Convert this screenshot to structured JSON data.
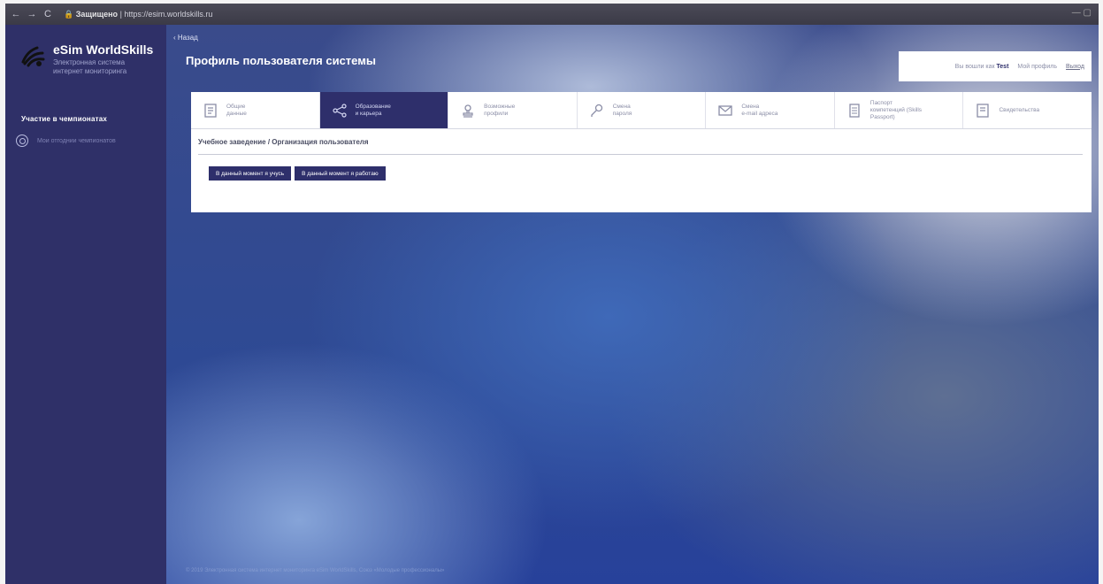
{
  "browser": {
    "nav": [
      "←",
      "→",
      "C"
    ],
    "url_secure_label": "Защищено",
    "url_text": "https://",
    "url_host": "esim.worldskills.ru",
    "window_controls": "— ▢"
  },
  "sidebar": {
    "brand_title": "eSim WorldSkills",
    "brand_subtitle": "Электронная система интернет мониторинга",
    "section_title": "Участие в чемпионатах",
    "items": [
      {
        "label": "Мои отгоднии чемпионатов",
        "icon": "soccer-ball-icon"
      }
    ]
  },
  "header": {
    "back_label": "‹ Назад",
    "page_title": "Профиль пользователя системы",
    "user_prefix": "Вы вошли как",
    "user_name": "Test",
    "profile_link": "Мой профиль",
    "logout_label": "Выход"
  },
  "tabs": [
    {
      "label": "Общие\nданные",
      "icon": "document-icon",
      "active": false
    },
    {
      "label": "Образование\nи карьера",
      "icon": "share-icon",
      "active": true
    },
    {
      "label": "Возможные\nпрофили",
      "icon": "stamp-icon",
      "active": false
    },
    {
      "label": "Смена\nпароля",
      "icon": "key-icon",
      "active": false
    },
    {
      "label": "Смена\ne-mail адреса",
      "icon": "mail-icon",
      "active": false
    },
    {
      "label": "Паспорт\nкомпетенций (Skills\nPassport)",
      "icon": "passport-icon",
      "active": false
    },
    {
      "label": "Свидетельства",
      "icon": "certificate-icon",
      "active": false
    }
  ],
  "panel": {
    "title": "Учебное заведение / Организация пользователя",
    "buttons": [
      "В данный момент я учусь",
      "В данный момент я работаю"
    ]
  },
  "footer": {
    "text": "© 2019 Электронная система интернет мониторинга eSim WorldSkills, Союз «Молодые профессионалы»"
  },
  "colors": {
    "primary": "#2e2f6b",
    "sidebar": "#2f3068",
    "panel": "#ffffff"
  }
}
